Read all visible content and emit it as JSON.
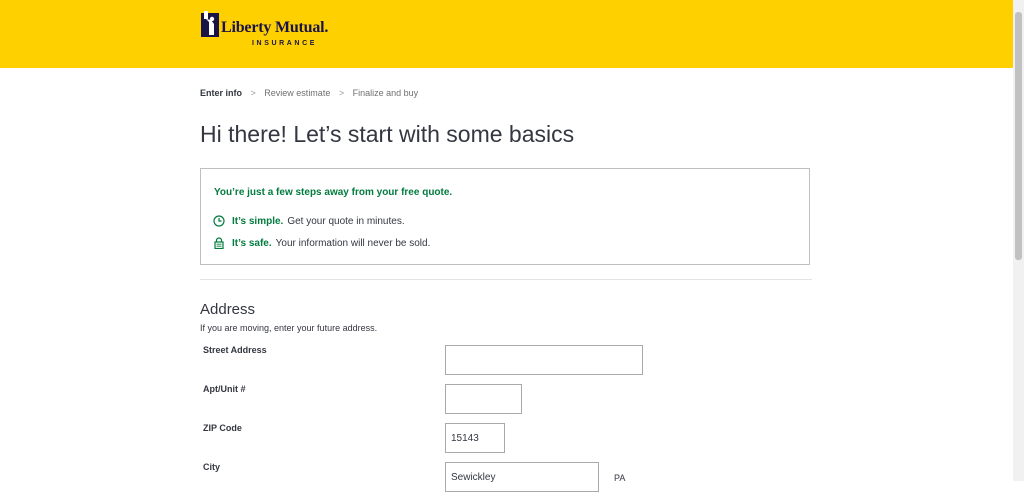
{
  "header": {
    "logo_name": "Liberty Mutual.",
    "logo_sub": "INSURANCE",
    "brand_color": "#ffd000",
    "logo_color": "#1a1446"
  },
  "breadcrumb": {
    "steps": [
      "Enter info",
      "Review estimate",
      "Finalize and buy"
    ],
    "separator": ">"
  },
  "page_title": "Hi there! Let’s start with some basics",
  "info": {
    "headline": "You’re just a few steps away from your free quote.",
    "accent_color": "#037b3f",
    "rows": [
      {
        "icon": "clock-icon",
        "bold": "It’s simple.",
        "text": "Get your quote in minutes."
      },
      {
        "icon": "lock-icon",
        "bold": "It’s safe.",
        "text": "Your information will never be sold."
      }
    ]
  },
  "address": {
    "title": "Address",
    "subtitle": "If you are moving, enter your future address.",
    "street_label": "Street Address",
    "street_value": "",
    "apt_label": "Apt/Unit #",
    "apt_value": "",
    "zip_label": "ZIP Code",
    "zip_value": "15143",
    "city_label": "City",
    "city_value": "Sewickley",
    "state_value": "PA"
  }
}
